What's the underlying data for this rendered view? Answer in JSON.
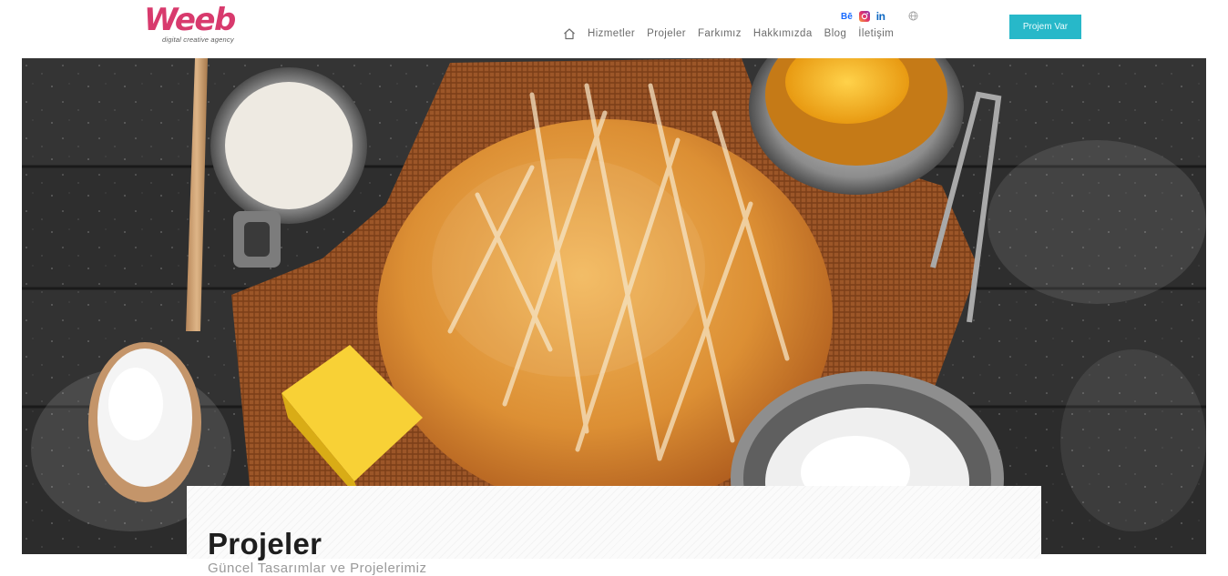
{
  "brand": {
    "logo_text": "Weeb",
    "tagline": "digital creative agency"
  },
  "social": {
    "behance": "Bē",
    "linkedin": "in"
  },
  "nav": {
    "items": [
      "Hizmetler",
      "Projeler",
      "Farkımız",
      "Hakkımızda",
      "Blog",
      "İletişim"
    ]
  },
  "cta": {
    "label": "Projem Var"
  },
  "hero": {
    "heading": "Projeler",
    "subheading": "Güncel Tasarımlar ve Projelerimiz"
  },
  "colors": {
    "brand_pink": "#d83a6d",
    "accent_teal": "#27b8c9",
    "nav_text": "#6c6c6c"
  }
}
